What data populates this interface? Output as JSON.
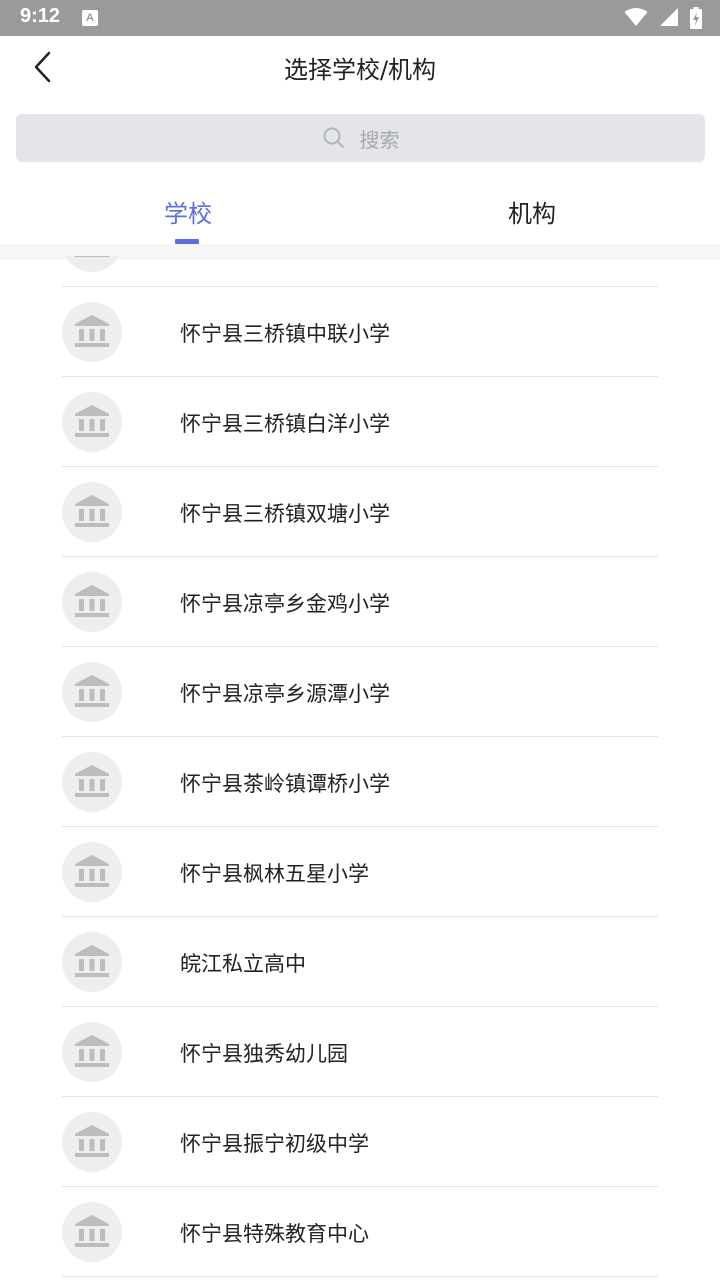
{
  "status_bar": {
    "time": "9:12",
    "notification_icon": "A"
  },
  "header": {
    "title": "选择学校/机构",
    "back_icon": "chevron-left-icon"
  },
  "search": {
    "placeholder": "搜索",
    "icon": "search-icon"
  },
  "tabs": [
    {
      "label": "学校",
      "active": true
    },
    {
      "label": "机构",
      "active": false
    }
  ],
  "colors": {
    "accent": "#5b6ee1",
    "status_bar": "#9a9a9a",
    "search_bg": "#e4e5ea",
    "icon_bg": "#eeeeee",
    "icon_fg": "#bdbdbd"
  },
  "school_list": [
    {
      "name": "",
      "icon": "school-building-icon"
    },
    {
      "name": "怀宁县三桥镇中联小学",
      "icon": "school-building-icon"
    },
    {
      "name": "怀宁县三桥镇白洋小学",
      "icon": "school-building-icon"
    },
    {
      "name": "怀宁县三桥镇双塘小学",
      "icon": "school-building-icon"
    },
    {
      "name": "怀宁县凉亭乡金鸡小学",
      "icon": "school-building-icon"
    },
    {
      "name": "怀宁县凉亭乡源潭小学",
      "icon": "school-building-icon"
    },
    {
      "name": "怀宁县茶岭镇谭桥小学",
      "icon": "school-building-icon"
    },
    {
      "name": "怀宁县枫林五星小学",
      "icon": "school-building-icon"
    },
    {
      "name": "皖江私立高中",
      "icon": "school-building-icon"
    },
    {
      "name": "怀宁县独秀幼儿园",
      "icon": "school-building-icon"
    },
    {
      "name": "怀宁县振宁初级中学",
      "icon": "school-building-icon"
    },
    {
      "name": "怀宁县特殊教育中心",
      "icon": "school-building-icon"
    }
  ]
}
